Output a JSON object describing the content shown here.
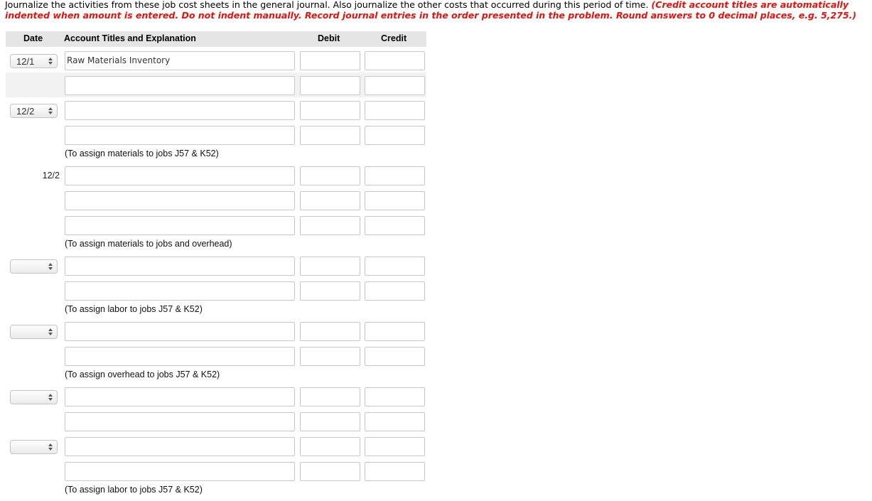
{
  "instructions": {
    "text": "Journalize the activities from these job cost sheets in the general journal. Also journalize the other costs that occurred during this period of time. ",
    "emphasis": "(Credit account titles are automatically indented when amount is entered. Do not indent manually. Record journal entries in the order presented in the problem. Round answers to 0 decimal places, e.g. 5,275.)"
  },
  "journal": {
    "headers": {
      "date": "Date",
      "account": "Account Titles and Explanation",
      "debit": "Debit",
      "credit": "Credit"
    },
    "rows": [
      {
        "date_type": "select",
        "date": "12/1",
        "account": "Raw Materials Inventory",
        "debit": "",
        "credit": ""
      },
      {
        "date_type": "none",
        "date": "",
        "account": "",
        "debit": "",
        "credit": ""
      },
      {
        "date_type": "select",
        "date": "12/2",
        "account": "",
        "debit": "",
        "credit": ""
      },
      {
        "date_type": "none",
        "date": "",
        "account": "",
        "debit": "",
        "credit": ""
      },
      {
        "date_type": "text",
        "date": "12/2",
        "account": "",
        "debit": "",
        "credit": ""
      },
      {
        "date_type": "none",
        "date": "",
        "account": "",
        "debit": "",
        "credit": ""
      },
      {
        "date_type": "none",
        "date": "",
        "account": "",
        "debit": "",
        "credit": ""
      },
      {
        "date_type": "select",
        "date": "",
        "account": "",
        "debit": "",
        "credit": ""
      },
      {
        "date_type": "none",
        "date": "",
        "account": "",
        "debit": "",
        "credit": ""
      },
      {
        "date_type": "select",
        "date": "",
        "account": "",
        "debit": "",
        "credit": ""
      },
      {
        "date_type": "none",
        "date": "",
        "account": "",
        "debit": "",
        "credit": ""
      },
      {
        "date_type": "select",
        "date": "",
        "account": "",
        "debit": "",
        "credit": ""
      },
      {
        "date_type": "none",
        "date": "",
        "account": "",
        "debit": "",
        "credit": ""
      },
      {
        "date_type": "select",
        "date": "",
        "account": "",
        "debit": "",
        "credit": ""
      },
      {
        "date_type": "none",
        "date": "",
        "account": "",
        "debit": "",
        "credit": ""
      }
    ],
    "notes": [
      "(To assign materials to jobs J57 & K52)",
      "(To assign materials to jobs and overhead)",
      "(To assign labor to jobs J57 & K52)",
      "(To assign overhead to jobs J57 & K52)",
      "(To assign labor to jobs J57 & K52)"
    ]
  }
}
